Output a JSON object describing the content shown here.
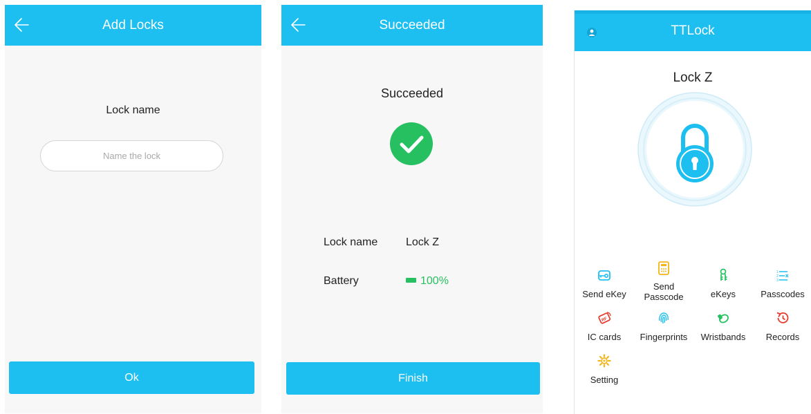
{
  "add_locks": {
    "title": "Add Locks",
    "lock_name_label": "Lock name",
    "name_placeholder": "Name the lock",
    "ok_label": "Ok"
  },
  "succeeded": {
    "title": "Succeeded",
    "heading": "Succeeded",
    "lock_name_label": "Lock name",
    "lock_name_value": "Lock Z",
    "battery_label": "Battery",
    "battery_value": "100%",
    "finish_label": "Finish"
  },
  "ttlock": {
    "title": "TTLock",
    "lock_name": "Lock Z",
    "menu": [
      {
        "label": "Send eKey",
        "icon": "send-ekey-icon"
      },
      {
        "label": "Send\nPasscode",
        "icon": "send-passcode-icon"
      },
      {
        "label": "eKeys",
        "icon": "ekeys-icon"
      },
      {
        "label": "Passcodes",
        "icon": "passcodes-icon"
      },
      {
        "label": "IC cards",
        "icon": "ic-card-icon"
      },
      {
        "label": "Fingerprints",
        "icon": "fingerprint-icon"
      },
      {
        "label": "Wristbands",
        "icon": "wristband-icon"
      },
      {
        "label": "Records",
        "icon": "records-icon"
      },
      {
        "label": "Setting",
        "icon": "setting-icon"
      }
    ]
  },
  "colors": {
    "accent": "#1cbff0",
    "success": "#27c061",
    "passcode": "#f2b61a",
    "records": "#e53b2c"
  }
}
